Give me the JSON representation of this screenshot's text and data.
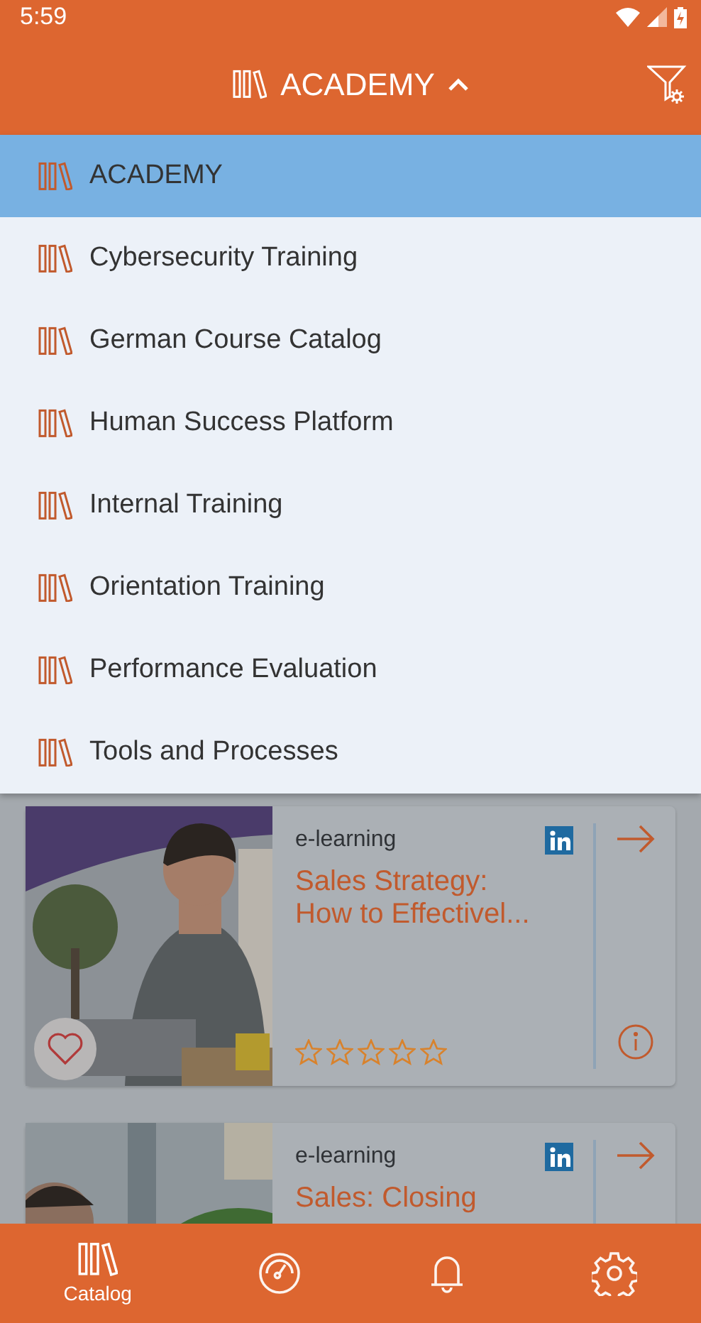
{
  "status_bar": {
    "time": "5:59"
  },
  "header": {
    "title": "ACADEMY",
    "expanded": true
  },
  "catalog_menu": [
    {
      "label": "ACADEMY",
      "selected": true
    },
    {
      "label": "Cybersecurity Training",
      "selected": false
    },
    {
      "label": "German Course Catalog",
      "selected": false
    },
    {
      "label": "Human Success Platform",
      "selected": false
    },
    {
      "label": "Internal Training",
      "selected": false
    },
    {
      "label": "Orientation Training",
      "selected": false
    },
    {
      "label": "Performance Evaluation",
      "selected": false
    },
    {
      "label": "Tools and Processes",
      "selected": false
    }
  ],
  "courses": [
    {
      "type": "e-learning",
      "title": "Sales Strategy: How to Effectivel...",
      "stars": 0,
      "favorite": false
    },
    {
      "type": "e-learning",
      "title": "Sales: Closing"
    }
  ],
  "tab_bar": [
    {
      "kind": "catalog",
      "label": "Catalog",
      "selected": true
    },
    {
      "kind": "dashboard",
      "selected": false
    },
    {
      "kind": "notifications",
      "selected": false
    },
    {
      "kind": "settings",
      "selected": false
    }
  ]
}
